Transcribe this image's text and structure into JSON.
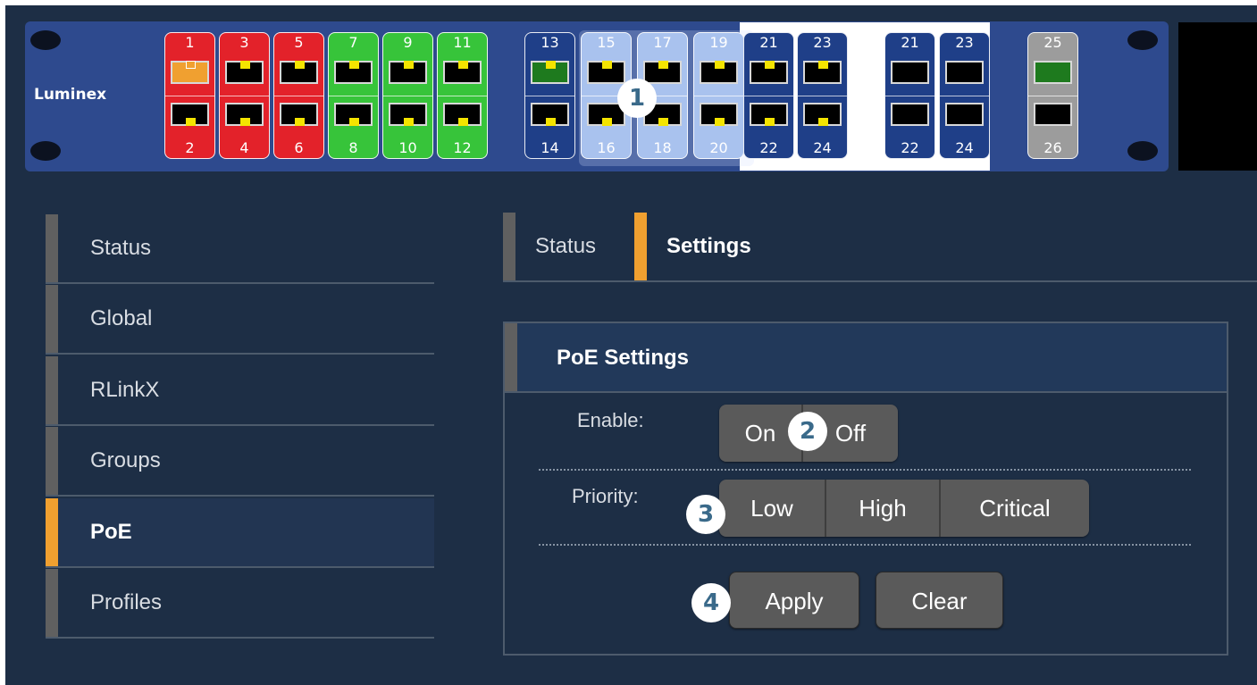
{
  "brand": "Luminex",
  "ports": {
    "group1_top": [
      "1",
      "3",
      "5",
      "7",
      "9",
      "11"
    ],
    "group1_bottom": [
      "2",
      "4",
      "6",
      "8",
      "10",
      "12"
    ],
    "group2_top": [
      "13",
      "15",
      "17",
      "19",
      "21",
      "23"
    ],
    "group2_bottom": [
      "14",
      "16",
      "18",
      "20",
      "22",
      "24"
    ],
    "group3_top": [
      "21",
      "23"
    ],
    "group3_bottom": [
      "22",
      "24"
    ],
    "sfp_top": "25",
    "sfp_bottom": "26"
  },
  "badges": [
    "1",
    "2",
    "3",
    "4"
  ],
  "sidebar": {
    "items": [
      {
        "label": "Status"
      },
      {
        "label": "Global"
      },
      {
        "label": "RLinkX"
      },
      {
        "label": "Groups"
      },
      {
        "label": "PoE"
      },
      {
        "label": "Profiles"
      }
    ]
  },
  "tabs": [
    {
      "label": "Status"
    },
    {
      "label": "Settings"
    }
  ],
  "poe_settings": {
    "title": "PoE Settings",
    "enable_label": "Enable:",
    "enable_options": [
      "On",
      "Off"
    ],
    "priority_label": "Priority:",
    "priority_options": [
      "Low",
      "High",
      "Critical"
    ],
    "apply_label": "Apply",
    "clear_label": "Clear"
  },
  "colors": {
    "background": "#1d2e45",
    "accent": "#f0a030",
    "port_red": "#e3222a",
    "port_green": "#37c43a",
    "port_blue": "#1f3f88",
    "port_selected": "#a9c2ee"
  }
}
